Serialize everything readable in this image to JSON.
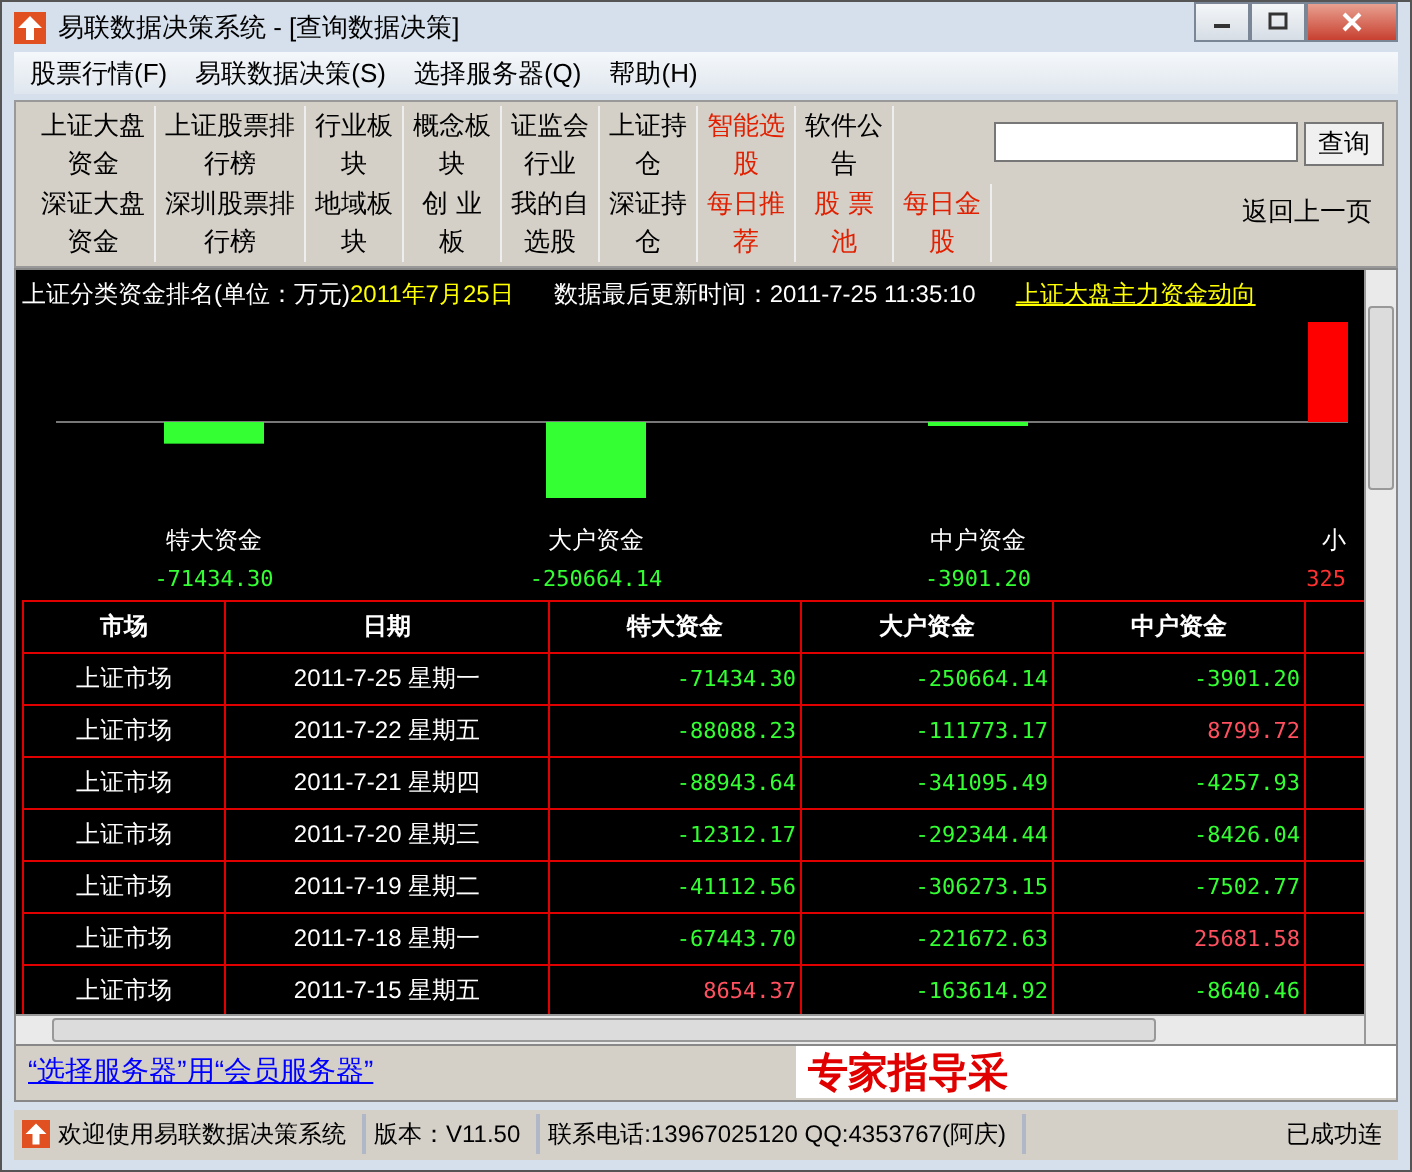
{
  "window": {
    "title": "易联数据决策系统 - [查询数据决策]"
  },
  "menu": [
    "股票行情(F)",
    "易联数据决策(S)",
    "选择服务器(Q)",
    "帮助(H)"
  ],
  "toolbar": {
    "rows": [
      [
        {
          "label": "上证大盘资金",
          "highlighted": false
        },
        {
          "label": "上证股票排行榜",
          "highlighted": false
        },
        {
          "label": "行业板块",
          "highlighted": false
        },
        {
          "label": "概念板块",
          "highlighted": false
        },
        {
          "label": "证监会行业",
          "highlighted": false
        },
        {
          "label": "上证持仓",
          "highlighted": false
        },
        {
          "label": "智能选股",
          "highlighted": true
        },
        {
          "label": "软件公告",
          "highlighted": false
        }
      ],
      [
        {
          "label": "深证大盘资金",
          "highlighted": false
        },
        {
          "label": "深圳股票排行榜",
          "highlighted": false
        },
        {
          "label": "地域板块",
          "highlighted": false
        },
        {
          "label": "创 业板",
          "highlighted": false
        },
        {
          "label": "我的自选股",
          "highlighted": false
        },
        {
          "label": "深证持仓",
          "highlighted": false
        },
        {
          "label": "每日推荐",
          "highlighted": true
        },
        {
          "label": "股 票池",
          "highlighted": true
        },
        {
          "label": "每日金股",
          "highlighted": true
        }
      ]
    ]
  },
  "search": {
    "button": "查询"
  },
  "back_link": "返回上一页",
  "panel": {
    "title": "上证分类资金排名(单位：万元)",
    "date": "2011年7月25日",
    "updated": "数据最后更新时间：2011-7-25 11:35:10",
    "link": "上证大盘主力资金动向",
    "chart_data": {
      "type": "bar",
      "categories": [
        "特大资金",
        "大户资金",
        "中户资金"
      ],
      "values": [
        -71434.3,
        -250664.14,
        -3901.2
      ],
      "value_labels": [
        "-71434.30",
        "-250664.14",
        "-3901.20"
      ]
    },
    "clipped_bar": {
      "label": "小",
      "value": "325"
    }
  },
  "table": {
    "columns": [
      "市场",
      "日期",
      "特大资金",
      "大户资金",
      "中户资金"
    ],
    "rows": [
      [
        "上证市场",
        "2011-7-25 星期一",
        "-71434.30",
        "-250664.14",
        "-3901.20"
      ],
      [
        "上证市场",
        "2011-7-22 星期五",
        "-88088.23",
        "-111773.17",
        "8799.72"
      ],
      [
        "上证市场",
        "2011-7-21 星期四",
        "-88943.64",
        "-341095.49",
        "-4257.93"
      ],
      [
        "上证市场",
        "2011-7-20 星期三",
        "-12312.17",
        "-292344.44",
        "-8426.04"
      ],
      [
        "上证市场",
        "2011-7-19 星期二",
        "-41112.56",
        "-306273.15",
        "-7502.77"
      ],
      [
        "上证市场",
        "2011-7-18 星期一",
        "-67443.70",
        "-221672.63",
        "25681.58"
      ],
      [
        "上证市场",
        "2011-7-15 星期五",
        "8654.37",
        "-163614.92",
        "-8640.46"
      ]
    ]
  },
  "notice": "“选择服务器”用“会员服务器”",
  "banner": "专家指导采",
  "status_bar": [
    "欢迎使用易联数据决策系统",
    "版本：V11.50",
    "联系电话:13967025120 QQ:4353767(阿庆)",
    "已成功连"
  ]
}
